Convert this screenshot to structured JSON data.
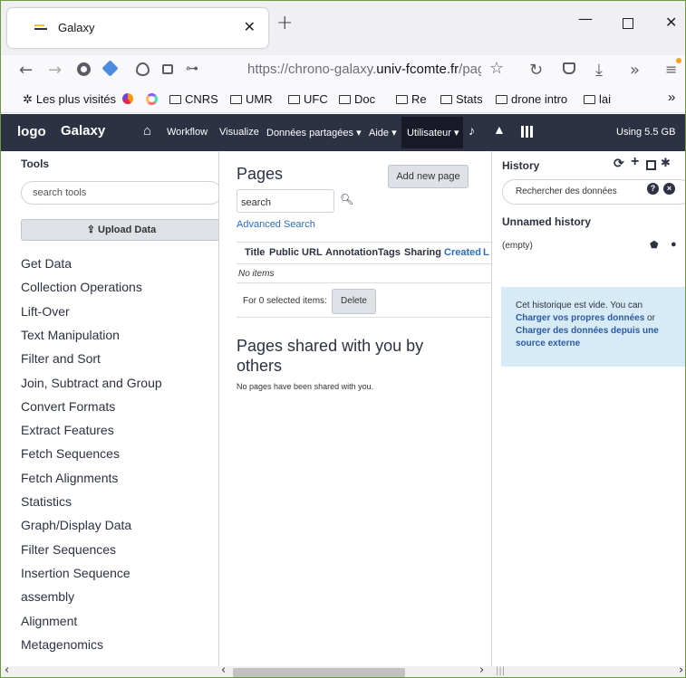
{
  "browser": {
    "tab_title": "Galaxy",
    "url_prefix": "https://chrono-galaxy.",
    "url_domain": "univ-fcomte.fr",
    "url_suffix": "/pag",
    "bookmarks": [
      "Les plus visités",
      "CNRS",
      "UMR",
      "UFC",
      "Doc",
      "Re",
      "Stats",
      "drone intro",
      "lai"
    ]
  },
  "masthead": {
    "logo": "logo",
    "brand": "Galaxy",
    "nav": [
      "Workflow",
      "Visualize",
      "Données partagées",
      "Aide",
      "Utilisateur"
    ],
    "usage": "Using 5.5 GB"
  },
  "tools": {
    "heading": "Tools",
    "search_placeholder": "search tools",
    "upload_label": "Upload Data",
    "sections": [
      "Get Data",
      "Collection Operations",
      "Lift-Over",
      "Text Manipulation",
      "Filter and Sort",
      "Join, Subtract and Group",
      "Convert Formats",
      "Extract Features",
      "Fetch Sequences",
      "Fetch Alignments",
      "Statistics",
      "Graph/Display Data",
      "Filter Sequences",
      "Insertion Sequence",
      "assembly",
      "Alignment",
      "Metagenomics"
    ]
  },
  "pages": {
    "title": "Pages",
    "add_button": "Add new page",
    "search_placeholder": "search",
    "advanced_search": "Advanced Search",
    "columns": [
      "Title",
      "Public URL",
      "Annotation",
      "Tags",
      "Sharing",
      "Created",
      "L"
    ],
    "no_items": "No items",
    "selected_label": "For 0 selected items:",
    "delete_button": "Delete",
    "shared_heading": "Pages shared with you by others",
    "shared_empty": "No pages have been shared with you."
  },
  "history": {
    "heading": "History",
    "search_placeholder": "Rechercher des données",
    "name": "Unnamed history",
    "size": "(empty)",
    "empty_msg": "Cet historique est vide. You can",
    "link1": "Charger vos propres données",
    "or": " or",
    "link2": "Charger des données depuis une source externe"
  },
  "colors": {
    "masthead": "#2c3143",
    "info_bg": "#d6eaf8",
    "link": "#2c6cbf"
  }
}
